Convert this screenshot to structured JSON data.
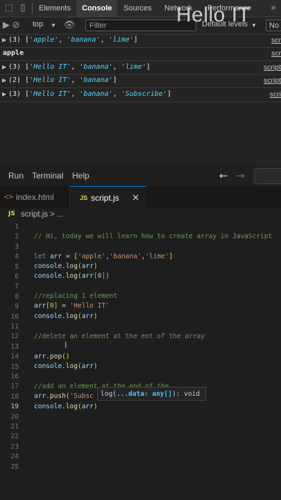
{
  "devtools": {
    "tabs": [
      "Elements",
      "Console",
      "Sources",
      "Network",
      "Performance"
    ],
    "active_tab": "Console",
    "context": "top",
    "filter_placeholder": "Filter",
    "levels": "Default levels",
    "no_issues": "No",
    "watermark": "Hello IT",
    "console": [
      {
        "count": "(3)",
        "items": [
          "'apple'",
          "'banana'",
          "'lime'"
        ],
        "source": "scr"
      },
      {
        "plain": "apple",
        "source": "scr"
      },
      {
        "count": "(3)",
        "items": [
          "'Hello IT'",
          "'banana'",
          "'lime'"
        ],
        "source": "script"
      },
      {
        "count": "(2)",
        "items": [
          "'Hello IT'",
          "'banana'"
        ],
        "source": "script"
      },
      {
        "count": "(3)",
        "items": [
          "'Hello IT'",
          "'banana'",
          "'Subscribe'"
        ],
        "source": "scri"
      }
    ]
  },
  "vscode": {
    "menu": [
      "Run",
      "Terminal",
      "Help"
    ],
    "tabs": [
      {
        "label": "index.html",
        "icon": "html-icon"
      },
      {
        "label": "script.js",
        "icon": "js-icon",
        "active": true
      }
    ],
    "breadcrumb": "script.js > ...",
    "js_badge": "JS",
    "code_lines": [
      "",
      "// Hi, today we will learn how to create array in JavaScript",
      "",
      "let arr = ['apple','banana','lime']",
      "console.log(arr)",
      "console.log(arr[0])",
      "",
      "//replacing 1 element",
      "arr[0] = 'Hello IT'",
      "console.log(arr)",
      "",
      "//delete an element at the ent of the array",
      "",
      "arr.pop()",
      "console.log(arr)",
      "",
      "//add an element at the end of the",
      "arr.push('Subsc",
      "console.log(arr)",
      "",
      "",
      "",
      "",
      "",
      ""
    ],
    "current_line": 19,
    "hint": {
      "name": "log(",
      "param": "...data: any[]",
      "tail": "): void"
    }
  }
}
